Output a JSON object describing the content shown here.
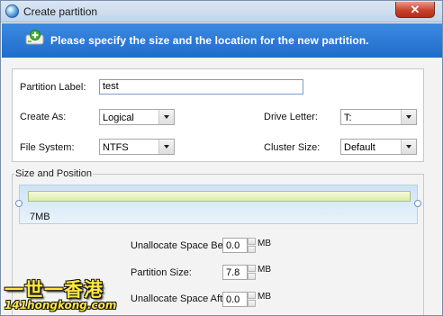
{
  "window": {
    "title": "Create partition",
    "close_label": "✕"
  },
  "banner": {
    "text": "Please specify the size and the location for the new partition."
  },
  "form": {
    "partition_label": {
      "label": "Partition Label:",
      "value": "test"
    },
    "create_as": {
      "label": "Create As:",
      "value": "Logical"
    },
    "drive_letter": {
      "label": "Drive Letter:",
      "value": "T:"
    },
    "file_system": {
      "label": "File System:",
      "value": "NTFS"
    },
    "cluster_size": {
      "label": "Cluster Size:",
      "value": "Default"
    }
  },
  "size_position": {
    "group_title": "Size and Position",
    "bar_size_label": "7MB",
    "unallocated_before": {
      "label": "Unallocate Space Before:",
      "value": "0.0",
      "unit": "MB"
    },
    "partition_size": {
      "label": "Partition Size:",
      "value": "7.8",
      "unit": "MB"
    },
    "unallocated_after": {
      "label": "Unallocate Space After:",
      "value": "0.0",
      "unit": "MB"
    }
  },
  "watermark": {
    "line1": "一世一香港",
    "line2": "141hongkong.com"
  },
  "colors": {
    "banner": "#1f6ccc",
    "bar_fill": "#dcedaa",
    "close_button": "#c9432b"
  }
}
